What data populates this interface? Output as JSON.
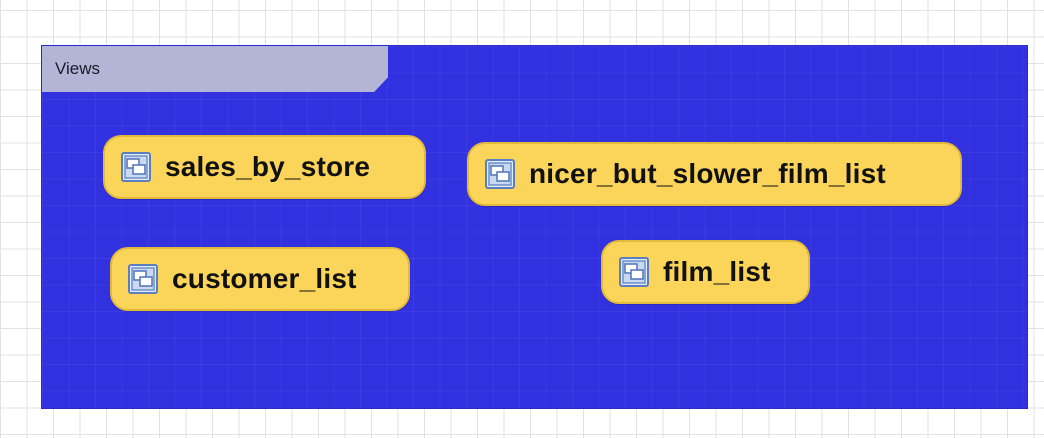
{
  "group": {
    "title": "Views"
  },
  "views": [
    {
      "id": "sales_by_store",
      "label": "sales_by_store",
      "icon": "view-icon"
    },
    {
      "id": "nicer_but_slower_film_list",
      "label": "nicer_but_slower_film_list",
      "icon": "view-icon"
    },
    {
      "id": "customer_list",
      "label": "customer_list",
      "icon": "view-icon"
    },
    {
      "id": "film_list",
      "label": "film_list",
      "icon": "view-icon"
    }
  ],
  "colors": {
    "group_fill": "#3131e0",
    "group_tab": "#b3b5d6",
    "node_fill": "#fbd45a",
    "node_border": "#e3b93c"
  }
}
